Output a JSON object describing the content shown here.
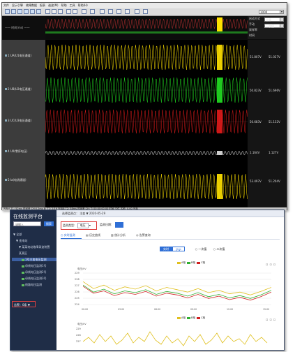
{
  "recorder": {
    "menu": [
      "文件",
      "显示引擎",
      "故障数据",
      "报表",
      "谐波(M)",
      "帮助",
      "工具",
      "帮助(H)"
    ],
    "right_box": [
      "启动方式",
      "手动",
      "采样率",
      "时间"
    ],
    "right_combos": [
      "1000",
      "全屏",
      "一次值"
    ],
    "channels": [
      {
        "label": "1 UA(U1电压通道)",
        "value": "51.807V",
        "value2": "51.027V",
        "color": "#ffe100"
      },
      {
        "label": "2 UB(U2电压通道)",
        "value": "50.823V",
        "value2": "51.696V",
        "color": "#22dd22"
      },
      {
        "label": "3 UC(U3电压通道)",
        "value": "50.683V",
        "value2": "51.132V",
        "color": "#e01b1b"
      },
      {
        "label": "4 U0(零序电压)",
        "value": "1.164V",
        "value2": "1.127V",
        "color": "#dddddd"
      },
      {
        "label": "5 Ia(电流通道)",
        "value": "53.497V",
        "value2": "51.204V",
        "color": "#ffe100"
      }
    ],
    "status": "光标A  T1: 52ms  时间差  CH:0.2ms  B: T2: 2/19  光标B  T2: 58ms  时间差  CH: T: 00:00:00.00  时间  文件  名称: 0.00  光标"
  },
  "monitor": {
    "sidebar_title": "在线监测平台",
    "search_placeholder": "请输入",
    "search_button": "搜索",
    "tree": [
      {
        "text": "▼ 全部",
        "level": 0,
        "sel": false
      },
      {
        "text": "▼ 变电站",
        "level": 1,
        "sel": false
      },
      {
        "text": "▼ 某某电站故障录波装置",
        "level": 2,
        "sel": false
      },
      {
        "text": "某某区",
        "level": 2,
        "sel": false
      },
      {
        "text": "1号主变电压监测",
        "level": 3,
        "sel": true
      },
      {
        "text": "母线电压监测1号",
        "level": 3,
        "sel": false
      },
      {
        "text": "母线电压监测2号",
        "level": 3,
        "sel": false
      },
      {
        "text": "母线电压监测3号",
        "level": 3,
        "sel": false
      },
      {
        "text": "线路电压监测",
        "level": 3,
        "sel": false
      }
    ],
    "alarm_box": "告警：0条 ▼",
    "top_text": "选择监测点：  主变  ▼    2020-05-29",
    "filter_label": "监测类型:",
    "filter_value": "电压",
    "filter_date_label": "监测日期:",
    "tabs": [
      "实时监测",
      "历史曲线",
      "统计分析",
      "告警查询"
    ],
    "seg_buttons": [
      "实时",
      "历史",
      "一次值",
      "二次值"
    ],
    "legend": [
      {
        "name": "A相",
        "color": "#e0c020"
      },
      {
        "name": "B相",
        "color": "#30b030"
      },
      {
        "name": "C相",
        "color": "#d02020"
      }
    ],
    "chart1_ylabel": "电压/kV",
    "chart1_yticks": [
      "229",
      "228",
      "227",
      "226",
      "225",
      "224"
    ],
    "chart1_xticks": [
      "00:00",
      "03:00",
      "06:00",
      "09:00",
      "12:00",
      "15:00"
    ],
    "chart2_ylabel": "电压/kV",
    "chart2_yticks": [
      "229",
      "228",
      "227"
    ]
  },
  "chart_data": [
    {
      "type": "line",
      "title": "",
      "ylabel": "电压/kV",
      "x": [
        "00:00",
        "03:00",
        "06:00",
        "09:00",
        "12:00",
        "15:00"
      ],
      "ylim": [
        223.5,
        229.5
      ],
      "series": [
        {
          "name": "A相",
          "values": [
            227.8,
            226.6,
            227.2,
            226.3,
            226.9,
            226.5,
            227.1,
            226.2,
            226.8,
            226.4,
            226.0,
            226.6,
            225.9,
            226.3,
            225.7,
            226.0,
            225.5,
            226.1,
            226.8
          ]
        },
        {
          "name": "B相",
          "values": [
            227.2,
            226.0,
            226.5,
            225.7,
            226.2,
            225.9,
            226.4,
            225.6,
            226.1,
            225.8,
            225.3,
            225.9,
            225.2,
            225.6,
            225.0,
            225.4,
            224.9,
            225.5,
            226.3
          ]
        },
        {
          "name": "C相",
          "values": [
            227.0,
            225.8,
            226.2,
            225.4,
            225.9,
            225.6,
            226.1,
            225.3,
            225.8,
            225.5,
            225.0,
            225.6,
            224.9,
            225.3,
            224.7,
            225.1,
            224.6,
            225.2,
            226.0
          ]
        }
      ]
    }
  ]
}
